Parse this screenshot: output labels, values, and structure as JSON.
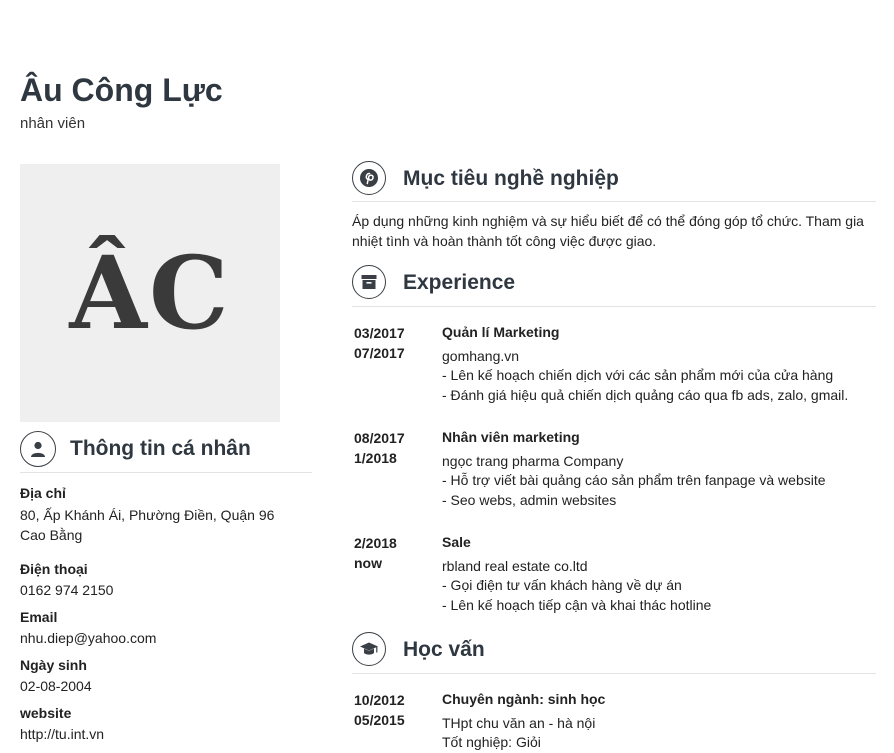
{
  "header": {
    "name": "Âu Công Lực",
    "job": "nhân viên"
  },
  "avatar": {
    "initials": "ÂC"
  },
  "personal": {
    "title": "Thông tin cá nhân",
    "fields": [
      {
        "label": "Địa chỉ",
        "value": "80, Ấp Khánh Ái, Phường Điền, Quận 96 Cao Bằng"
      },
      {
        "label": "Điện thoại",
        "value": "0162 974 2150"
      },
      {
        "label": "Email",
        "value": "nhu.diep@yahoo.com"
      },
      {
        "label": "Ngày sinh",
        "value": "02-08-2004"
      },
      {
        "label": "website",
        "value": "http://tu.int.vn"
      }
    ]
  },
  "objective": {
    "title": "Mục tiêu nghề nghiệp",
    "text": "Áp dụng những kinh nghiệm và sự hiểu biết để có thể đóng góp tổ chức. Tham gia nhiệt tình và hoàn thành tốt công việc được giao."
  },
  "experience": {
    "title": "Experience",
    "items": [
      {
        "start": "03/2017",
        "end": "07/2017",
        "role": "Quản lí Marketing",
        "company": "gomhang.vn",
        "lines": [
          "- Lên kế hoạch chiến dịch với các sản phẩm mới của cửa hàng",
          "- Đánh giá hiệu quả chiến dịch quảng cáo qua fb ads, zalo, gmail."
        ]
      },
      {
        "start": "08/2017",
        "end": "1/2018",
        "role": "Nhân viên marketing",
        "company": "ngọc trang pharma Company",
        "lines": [
          "- Hỗ trợ viết bài quảng cáo sản phẩm trên fanpage và website",
          "- Seo webs, admin websites"
        ]
      },
      {
        "start": "2/2018",
        "end": "now",
        "role": "Sale",
        "company": "rbland real estate co.ltd",
        "lines": [
          "- Gọi điện tư vấn khách hàng về dự án",
          "- Lên kế hoạch tiếp cận và khai thác hotline"
        ]
      }
    ]
  },
  "education": {
    "title": "Học vấn",
    "items": [
      {
        "start": "10/2012",
        "end": "05/2015",
        "major": "Chuyên ngành: sinh học",
        "school": "THpt chu văn an - hà nội",
        "grade": "Tốt nghiệp: Giỏi"
      }
    ]
  },
  "icons": {
    "personal": "user-icon",
    "objective": "pinterest-icon",
    "experience": "archive-box-icon",
    "education": "graduation-cap-icon"
  }
}
